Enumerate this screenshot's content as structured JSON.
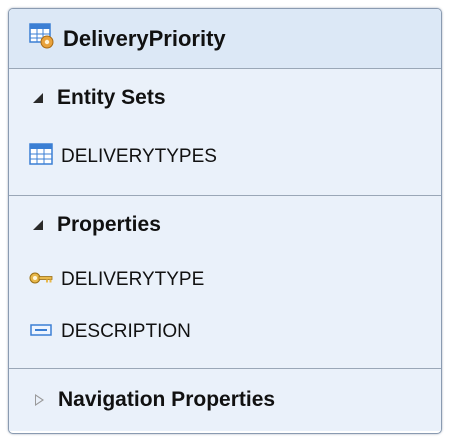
{
  "entity": {
    "title": "DeliveryPriority",
    "icon": "entity-type-icon"
  },
  "sections": {
    "entity_sets": {
      "title": "Entity Sets",
      "expanded": true,
      "items": [
        {
          "label": "DELIVERYTYPES",
          "icon": "entity-set-icon"
        }
      ]
    },
    "properties": {
      "title": "Properties",
      "expanded": true,
      "items": [
        {
          "label": "DELIVERYTYPE",
          "icon": "key-icon"
        },
        {
          "label": "DESCRIPTION",
          "icon": "property-icon"
        }
      ]
    },
    "navigation_properties": {
      "title": "Navigation Properties",
      "expanded": false
    }
  },
  "colors": {
    "header_bg": "#dce8f6",
    "section_bg": "#eaf1fa",
    "border": "#8a9bb1",
    "icon_blue": "#3b7fd4"
  }
}
